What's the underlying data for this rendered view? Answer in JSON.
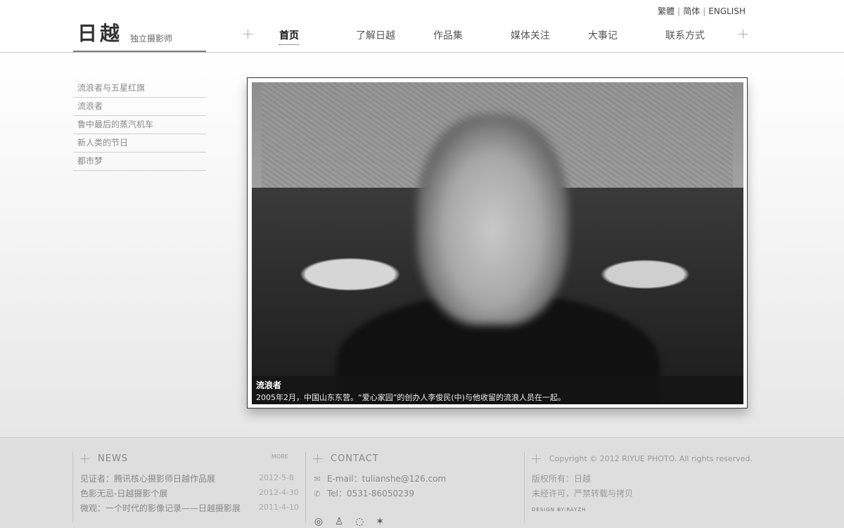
{
  "lang": {
    "trad": "繁體",
    "simp": "简体",
    "eng": "ENGLISH",
    "sep": "|"
  },
  "logo": {
    "mark": "日越",
    "subtitle": "独立摄影师"
  },
  "nav": [
    {
      "label": "首页",
      "active": true
    },
    {
      "label": "了解日越"
    },
    {
      "label": "作品集"
    },
    {
      "label": "媒体关注"
    },
    {
      "label": "大事记"
    },
    {
      "label": "联系方式"
    }
  ],
  "sidebar": [
    "流浪者与五星红旗",
    "流浪者",
    "鲁中最后的蒸汽机车",
    "新人类的节日",
    "都市梦"
  ],
  "photo": {
    "title": "流浪者",
    "description": "2005年2月，中国山东东营。“爱心家园”的创办人李俊民(中)与他收留的流浪人员在一起。"
  },
  "news": {
    "title": "NEWS",
    "more": "MORE",
    "items": [
      {
        "text": "见证者：腾讯核心摄影师日越作品展",
        "date": "2012-5-8"
      },
      {
        "text": "色影无忌-日越摄影个展",
        "date": "2012-4-30"
      },
      {
        "text": "微观：一个时代的影像记录——日越摄影展",
        "date": "2011-4-10"
      }
    ]
  },
  "contact": {
    "title": "CONTACT",
    "email": "E-mail：tulianshe@126.com",
    "tel": "Tel：0531-86050239",
    "icons": [
      "weibo-icon",
      "qq-icon",
      "chat-icon",
      "star-icon"
    ]
  },
  "copyright": {
    "text": "Copyright © 2012 RIYUE PHOTO. All rights reserved.",
    "owner": "版权所有：日越",
    "notice": "未经许可，严禁转载与拷贝",
    "design": "DESIGN BY:RAYZH"
  }
}
